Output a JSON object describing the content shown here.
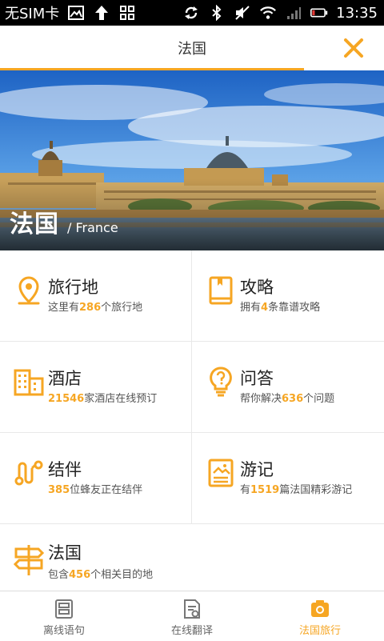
{
  "status": {
    "carrier": "无SIM卡",
    "time": "13:35"
  },
  "header": {
    "title": "法国"
  },
  "hero": {
    "title_cn": "法国",
    "title_en": "/ France"
  },
  "cards": [
    {
      "title": "旅行地",
      "pre": "这里有",
      "num": "286",
      "post": "个旅行地",
      "icon": "location-pin-icon"
    },
    {
      "title": "攻略",
      "pre": "拥有",
      "num": "4",
      "post": "条靠谱攻略",
      "icon": "book-icon"
    },
    {
      "title": "酒店",
      "pre": "",
      "num": "21546",
      "post": "家酒店在线预订",
      "icon": "building-icon"
    },
    {
      "title": "问答",
      "pre": "帮你解决",
      "num": "636",
      "post": "个问题",
      "icon": "lightbulb-question-icon"
    },
    {
      "title": "结伴",
      "pre": "",
      "num": "385",
      "post": "位蜂友正在结伴",
      "icon": "route-icon"
    },
    {
      "title": "游记",
      "pre": "有",
      "num": "1519",
      "post": "篇法国精彩游记",
      "icon": "journal-icon"
    },
    {
      "title": "法国",
      "pre": "包含",
      "num": "456",
      "post": "个相关目的地",
      "icon": "signpost-icon"
    }
  ],
  "tabs": [
    {
      "label": "离线语句",
      "icon": "phrasebook-icon",
      "active": false
    },
    {
      "label": "在线翻译",
      "icon": "translate-doc-icon",
      "active": false
    },
    {
      "label": "法国旅行",
      "icon": "camera-icon",
      "active": true
    }
  ],
  "colors": {
    "accent": "#f6a623",
    "status_bg": "#000000"
  }
}
